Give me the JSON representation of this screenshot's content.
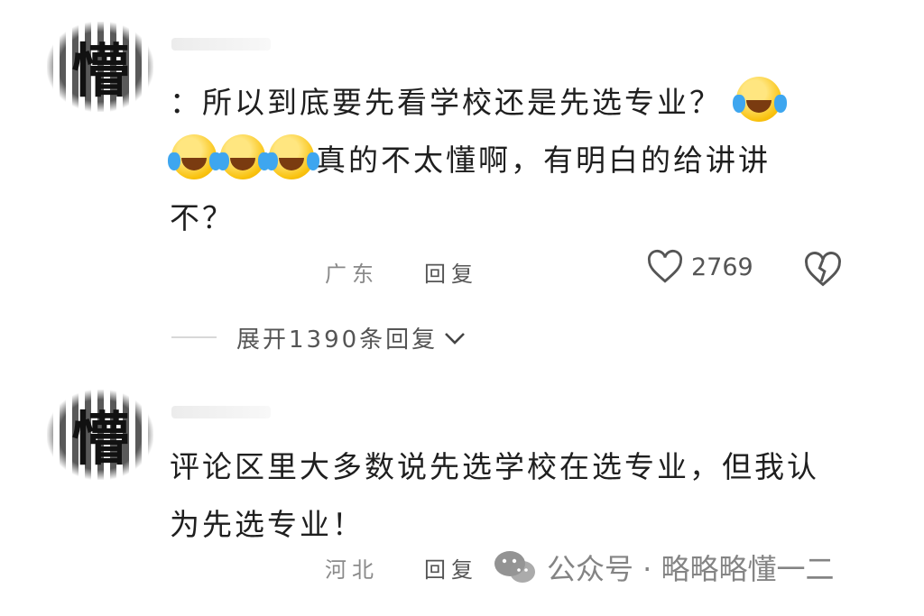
{
  "comments": [
    {
      "text_prefix": "：所以到底要先看学校还是先选专业？",
      "text_mid": "真的不太懂啊，有明白的给讲讲",
      "text_suffix": "不？",
      "location": "广东",
      "reply_label": "回复",
      "likes": "2769",
      "expand_label": "展开1390条回复",
      "avatar_icon": "blurred-avatar",
      "emoji_icon": "laughing-tears-emoji"
    },
    {
      "text": "评论区里大多数说先选学校在选专业，但我认为先选专业！",
      "location": "河北",
      "reply_label": "回复",
      "avatar_icon": "blurred-avatar"
    }
  ],
  "watermark": {
    "label": "公众号 · 略略略懂一二",
    "icon": "wechat-icon"
  },
  "colors": {
    "text": "#1f1f1f",
    "meta": "#8a8a8a",
    "emoji": "#f9c20e"
  }
}
